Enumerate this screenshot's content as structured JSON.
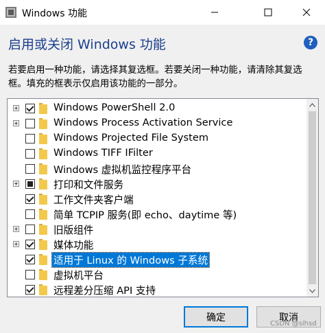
{
  "window": {
    "title": "Windows 功能",
    "heading": "启用或关闭 Windows 功能",
    "help_label": "?",
    "description": "若要启用一种功能，请选择其复选框。若要关闭一种功能，请清除其复选框。填充的框表示仅启用该功能的一部分。"
  },
  "features": [
    {
      "label": "Windows PowerShell 2.0",
      "state": "checked",
      "expandable": true
    },
    {
      "label": "Windows Process Activation Service",
      "state": "unchecked",
      "expandable": true
    },
    {
      "label": "Windows Projected File System",
      "state": "unchecked",
      "expandable": false
    },
    {
      "label": "Windows TIFF IFilter",
      "state": "unchecked",
      "expandable": false
    },
    {
      "label": "Windows 虚拟机监控程序平台",
      "state": "unchecked",
      "expandable": false
    },
    {
      "label": "打印和文件服务",
      "state": "partial",
      "expandable": true
    },
    {
      "label": "工作文件夹客户端",
      "state": "checked",
      "expandable": false
    },
    {
      "label": "简单 TCPIP 服务(即 echo、daytime 等)",
      "state": "unchecked",
      "expandable": false
    },
    {
      "label": "旧版组件",
      "state": "unchecked",
      "expandable": true
    },
    {
      "label": "媒体功能",
      "state": "checked",
      "expandable": true
    },
    {
      "label": "适用于 Linux 的 Windows 子系统",
      "state": "checked",
      "expandable": false,
      "selected": true
    },
    {
      "label": "虚拟机平台",
      "state": "unchecked",
      "expandable": false
    },
    {
      "label": "远程差分压缩 API 支持",
      "state": "checked",
      "expandable": false
    }
  ],
  "buttons": {
    "ok": "确定",
    "cancel": "取消"
  },
  "watermark": "CSDN @sihsd",
  "colors": {
    "accent": "#0078d7",
    "heading": "#1a3e8c",
    "folder": "#f2c94c"
  }
}
